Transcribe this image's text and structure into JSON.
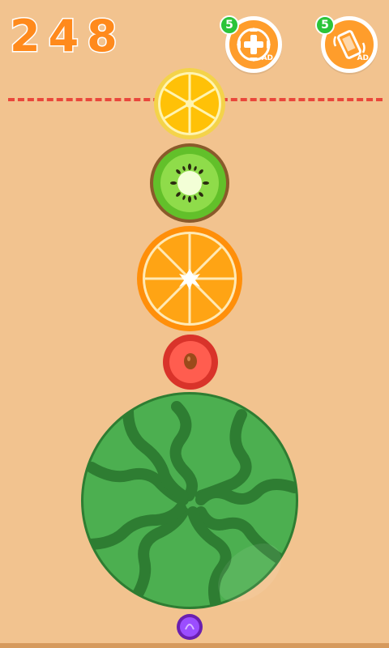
{
  "score": "248",
  "powerups": [
    {
      "name": "merge-power",
      "count": "5",
      "ad_label": "AD",
      "icon": "plus-arrows-icon"
    },
    {
      "name": "shake-power",
      "count": "5",
      "ad_label": "AD",
      "icon": "phone-shake-icon"
    }
  ],
  "fruits": [
    "lemon",
    "kiwi",
    "orange",
    "cherry",
    "watermelon",
    "grape"
  ],
  "colors": {
    "background": "#f2c38f",
    "score": "#ff8a1c",
    "limit_line": "#e9473b",
    "badge": "#2bc43a"
  }
}
